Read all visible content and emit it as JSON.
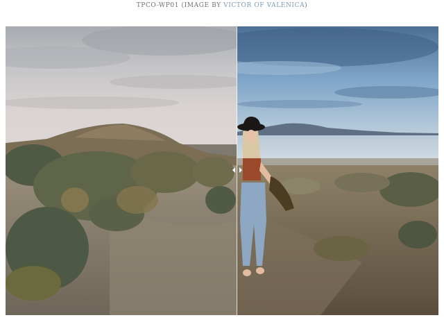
{
  "caption": {
    "prefix": "TPCO-WP01 (IMAGE BY ",
    "credit": "VICTOR OF VALENICA",
    "suffix": ")"
  },
  "comparison": {
    "before_label": "before-image",
    "after_label": "after-image",
    "handle_icon": "left-right-arrows-icon"
  },
  "colors": {
    "link": "#7a9ab5",
    "caption_text": "#6f6f6f"
  }
}
